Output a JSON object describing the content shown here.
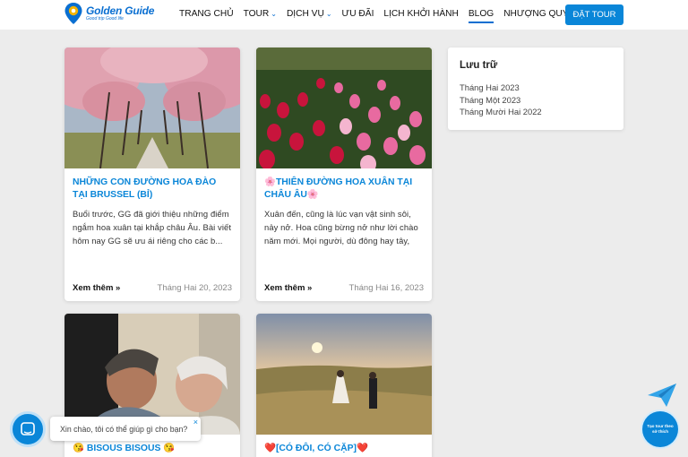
{
  "header": {
    "logo_title": "Golden Guide",
    "logo_tagline": "Good trip Good life",
    "nav": [
      {
        "label": "TRANG CHỦ",
        "has_caret": false,
        "active": false
      },
      {
        "label": "TOUR",
        "has_caret": true,
        "active": false
      },
      {
        "label": "DỊCH VỤ",
        "has_caret": true,
        "active": false
      },
      {
        "label": "ƯU ĐÃI",
        "has_caret": false,
        "active": false
      },
      {
        "label": "LỊCH KHỞI HÀNH",
        "has_caret": false,
        "active": false
      },
      {
        "label": "BLOG",
        "has_caret": false,
        "active": true
      },
      {
        "label": "NHƯỢNG QUYỀN",
        "has_caret": false,
        "active": false
      }
    ],
    "book_button": "ĐẶT TOUR"
  },
  "posts": [
    {
      "title": "NHỮNG CON ĐƯỜNG HOA ĐÀO TẠI BRUSSEL (BỈ)",
      "excerpt": "Buổi trước, GG đã giới thiệu những điểm ngắm hoa xuân tại khắp châu Âu. Bài viết hôm nay GG sẽ ưu ái riêng cho các b...",
      "read_more": "Xem thêm »",
      "date": "Tháng Hai 20, 2023",
      "image": "cherry-blossom-avenue"
    },
    {
      "title": "🌸THIÊN ĐƯỜNG HOA XUÂN TẠI CHÂU ÂU🌸",
      "excerpt": "Xuân đến, cũng là lúc vạn vật sinh sôi, nảy nở. Hoa cũng bừng nở như lời chào năm mới. Mọi người, dù đông hay tây, đều ...",
      "read_more": "Xem thêm »",
      "date": "Tháng Hai 16, 2023",
      "image": "tulip-field"
    },
    {
      "title": "😘 BISOUS BISOUS 😘",
      "image": "couple-kiss-photo"
    },
    {
      "title": "❤️[CÓ ĐÔI, CÓ CẶP]❤️",
      "image": "wedding-couple-sunset"
    }
  ],
  "archive": {
    "title": "Lưu trữ",
    "items": [
      "Tháng Hai 2023",
      "Tháng Một 2023",
      "Tháng Mười Hai 2022"
    ]
  },
  "chat": {
    "message": "Xin chào, tôi có thể giúp gì cho bạn?",
    "close": "×"
  },
  "tour_widget": {
    "label": "Tạo tour theo sở thích"
  },
  "colors": {
    "brand": "#0a86d8",
    "background": "#ececec"
  }
}
